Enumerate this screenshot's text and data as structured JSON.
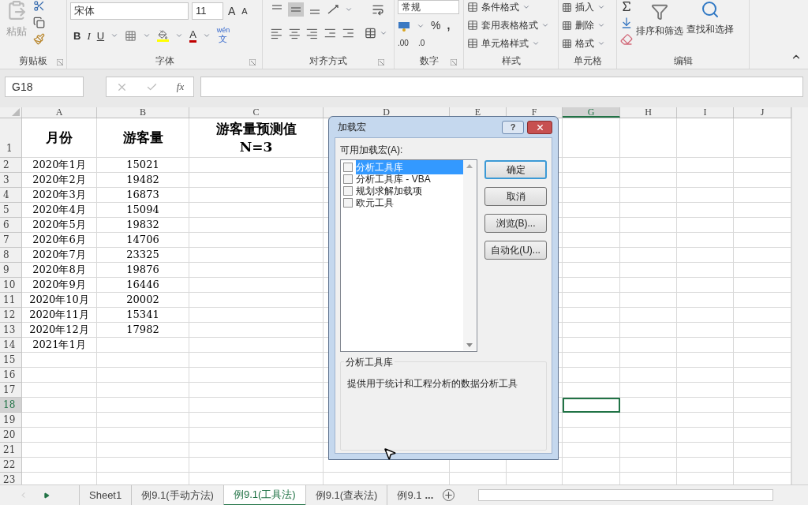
{
  "ribbon": {
    "clipboard": {
      "paste": "粘贴",
      "label": "剪贴板"
    },
    "font": {
      "name": "宋体",
      "size": "11",
      "grow": "A",
      "shrink": "A",
      "bold": "B",
      "italic": "I",
      "underline": "U",
      "font_color": "A",
      "phonetic_top": "wén",
      "phonetic_bottom": "文",
      "label": "字体"
    },
    "alignment": {
      "label": "对齐方式",
      "middle_selected": true
    },
    "number": {
      "format": "常规",
      "percent": "%",
      "comma": ",",
      "increase_decimal": ".00",
      "decrease_decimal": ".0",
      "label": "数字"
    },
    "styles": {
      "items": [
        "条件格式",
        "套用表格格式",
        "单元格样式"
      ],
      "label": "样式"
    },
    "cells": {
      "items": [
        "插入",
        "删除",
        "格式"
      ],
      "label": "单元格"
    },
    "editing": {
      "sort": "排序和筛选",
      "find": "查找和选择",
      "label": "编辑"
    }
  },
  "formula_bar": {
    "name_box": "G18",
    "fx": "fx"
  },
  "columns": [
    {
      "label": "A",
      "selected": false
    },
    {
      "label": "B",
      "selected": false
    },
    {
      "label": "C",
      "selected": false
    },
    {
      "label": "D",
      "selected": false
    },
    {
      "label": "E",
      "selected": false
    },
    {
      "label": "F",
      "selected": false
    },
    {
      "label": "G",
      "selected": true
    },
    {
      "label": "H",
      "selected": false
    },
    {
      "label": "I",
      "selected": false
    },
    {
      "label": "J",
      "selected": false
    }
  ],
  "header_row": {
    "row": "1",
    "month": "月份",
    "visitors": "游客量",
    "forecast_line1": "游客量预测值",
    "forecast_line2": "N=3"
  },
  "rows": [
    {
      "row": "2",
      "month": "2020年1月",
      "visitors": "15021",
      "selected": false
    },
    {
      "row": "3",
      "month": "2020年2月",
      "visitors": "19482",
      "selected": false
    },
    {
      "row": "4",
      "month": "2020年3月",
      "visitors": "16873",
      "selected": false
    },
    {
      "row": "5",
      "month": "2020年4月",
      "visitors": "15094",
      "selected": false
    },
    {
      "row": "6",
      "month": "2020年5月",
      "visitors": "19832",
      "selected": false
    },
    {
      "row": "7",
      "month": "2020年6月",
      "visitors": "14706",
      "selected": false
    },
    {
      "row": "8",
      "month": "2020年7月",
      "visitors": "23325",
      "selected": false
    },
    {
      "row": "9",
      "month": "2020年8月",
      "visitors": "19876",
      "selected": false
    },
    {
      "row": "10",
      "month": "2020年9月",
      "visitors": "16446",
      "selected": false
    },
    {
      "row": "11",
      "month": "2020年10月",
      "visitors": "20002",
      "selected": false
    },
    {
      "row": "12",
      "month": "2020年11月",
      "visitors": "15341",
      "selected": false
    },
    {
      "row": "13",
      "month": "2020年12月",
      "visitors": "17982",
      "selected": false
    },
    {
      "row": "14",
      "month": "2021年1月",
      "selected": false
    },
    {
      "row": "15",
      "selected": false
    },
    {
      "row": "16",
      "selected": false
    },
    {
      "row": "17",
      "selected": false
    },
    {
      "row": "18",
      "selected": true
    },
    {
      "row": "19",
      "selected": false
    },
    {
      "row": "20",
      "selected": false
    },
    {
      "row": "21",
      "selected": false
    },
    {
      "row": "22",
      "selected": false
    },
    {
      "row": "23",
      "selected": false
    }
  ],
  "dialog": {
    "title": "加载宏",
    "help": "?",
    "list_label": "可用加载宏(A):",
    "addins": [
      {
        "label": "分析工具库",
        "checked": false,
        "selected": true
      },
      {
        "label": "分析工具库 - VBA",
        "checked": false,
        "selected": false
      },
      {
        "label": "规划求解加载项",
        "checked": false,
        "selected": false
      },
      {
        "label": "欧元工具",
        "checked": false,
        "selected": false
      }
    ],
    "buttons": [
      {
        "label": "确定",
        "default": true
      },
      {
        "label": "取消",
        "default": false
      },
      {
        "label": "浏览(B)...",
        "default": false
      },
      {
        "label": "自动化(U)...",
        "default": false
      }
    ],
    "description_title": "分析工具库",
    "description": "提供用于统计和工程分析的数据分析工具"
  },
  "sheet_tabs": [
    {
      "label": "Sheet1",
      "selected": false
    },
    {
      "label": "例9.1(手动方法)",
      "selected": false
    },
    {
      "label": "例9.1(工具法)",
      "selected": true
    },
    {
      "label": "例9.1(查表法)",
      "selected": false
    },
    {
      "label": "例9.1",
      "selected": false
    }
  ],
  "more_tabs": "..."
}
